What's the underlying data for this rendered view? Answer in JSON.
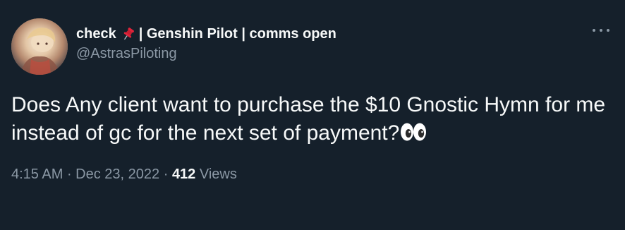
{
  "author": {
    "name_before_emoji": "check",
    "name_after_emoji": "| Genshin Pilot | comms open",
    "name_emoji_icon": "pushpin-icon",
    "handle": "@AstrasPiloting",
    "avatar_icon": "profile-avatar"
  },
  "more_icon": "more-options-icon",
  "tweet": {
    "text": "Does Any client want to purchase the $10 Gnostic Hymn for me instead of gc for the next set of payment?",
    "trailing_emoji_icon": "eyes-emoji-icon"
  },
  "meta": {
    "time": "4:15 AM",
    "separator": " · ",
    "date": "Dec 23, 2022",
    "separator2": " · ",
    "views_count": "412",
    "views_label": " Views"
  },
  "colors": {
    "background": "#15202b",
    "primary_text": "#f7f9f9",
    "secondary_text": "#8b98a5"
  }
}
